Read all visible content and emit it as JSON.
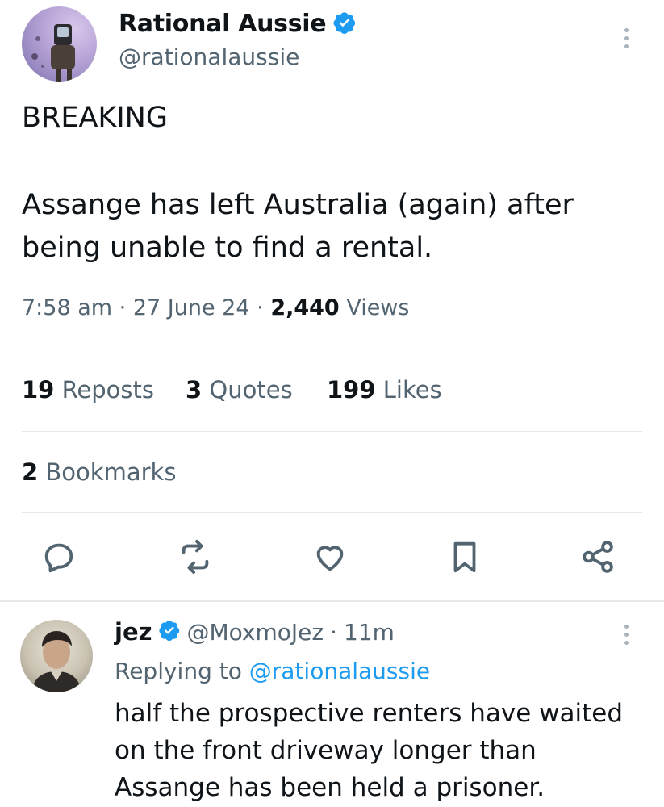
{
  "tweet": {
    "display_name": "Rational Aussie",
    "handle": "@rationalaussie",
    "verified_icon": "verified-badge-icon",
    "text_line1": "BREAKING",
    "text_line2": "Assange has left Australia (again) after",
    "text_line3": "being unable to find a rental.",
    "time": "7:58 am",
    "date": "27 June 24",
    "views_count": "2,440",
    "views_label": "Views",
    "sep": "·"
  },
  "stats": {
    "reposts_count": "19",
    "reposts_label": "Reposts",
    "quotes_count": "3",
    "quotes_label": "Quotes",
    "likes_count": "199",
    "likes_label": "Likes",
    "bookmarks_count": "2",
    "bookmarks_label": "Bookmarks"
  },
  "actions": [
    "reply-icon",
    "repost-icon",
    "like-icon",
    "bookmark-icon",
    "share-icon"
  ],
  "reply": {
    "display_name": "jez",
    "handle": "@MoxmoJez",
    "time": "11m",
    "sep": "·",
    "replying_prefix": "Replying to",
    "replying_handle": "@rationalaussie",
    "text_line1": "half the prospective renters have waited",
    "text_line2": "on the front driveway longer than",
    "text_line3": "Assange has been held a prisoner."
  },
  "colors": {
    "link": "#1d9bf0",
    "secondary_text": "#536471",
    "primary_text": "#0f1419",
    "verified": "#1d9bf0"
  }
}
